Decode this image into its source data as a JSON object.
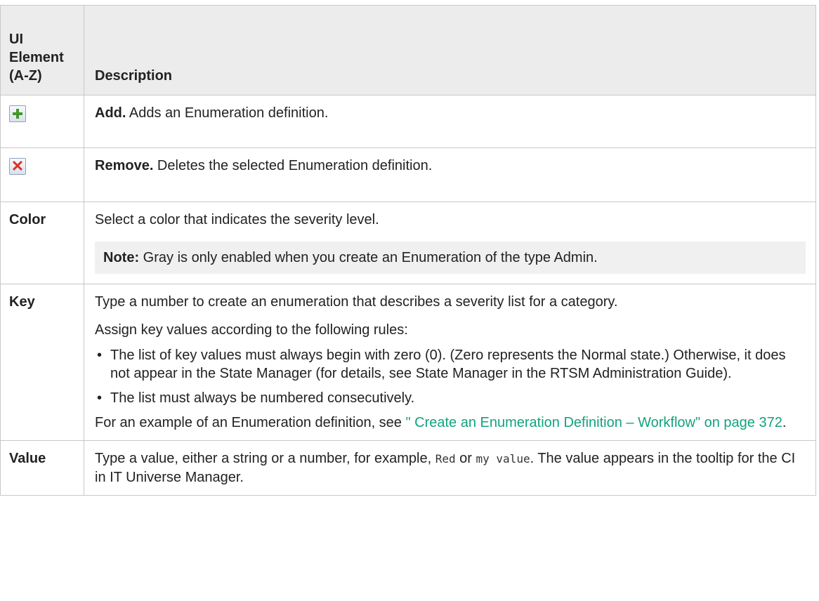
{
  "table": {
    "header": {
      "col1": "UI Element (A-Z)",
      "col2": "Description"
    },
    "add_row": {
      "icon": "add-plus-icon",
      "bold": "Add.",
      "text": " Adds an Enumeration definition."
    },
    "remove_row": {
      "icon": "remove-x-icon",
      "bold": "Remove.",
      "text": " Deletes the selected Enumeration definition."
    },
    "color_row": {
      "label": "Color",
      "text": "Select a color that indicates the severity level.",
      "note_bold": "Note:",
      "note_text": " Gray is only enabled when you create an Enumeration of the type Admin."
    },
    "key_row": {
      "label": "Key",
      "text1": "Type a number to create an enumeration that describes a severity list for a category.",
      "text2": "Assign key values according to the following rules:",
      "bullets": [
        "The list of key values must always begin with zero (0). (Zero represents the Normal state.) Otherwise, it does not appear in the State Manager (for details, see State Manager in the RTSM Administration Guide).",
        "The list must always be numbered consecutively."
      ],
      "example_prefix": "For an example of an Enumeration definition, see ",
      "example_link": "\" Create an Enumeration Definition – Workflow\" on page 372",
      "example_suffix": "."
    },
    "value_row": {
      "label": "Value",
      "text_a": "Type a value, either a string or a number, for example, ",
      "code1": "Red",
      "text_b": " or ",
      "code2": "my value",
      "text_c": ". The value appears in the tooltip for the CI in IT Universe Manager."
    }
  }
}
